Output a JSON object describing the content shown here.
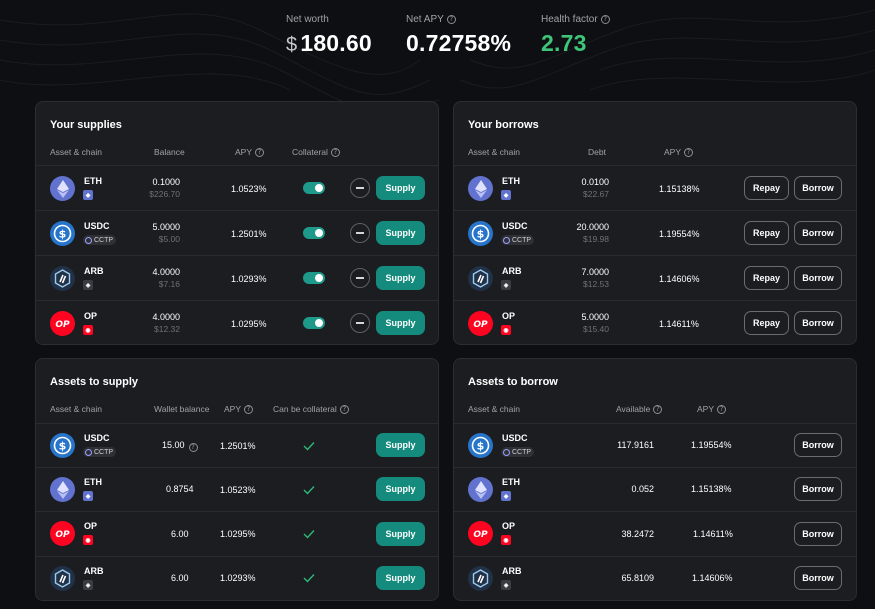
{
  "stats": {
    "net_worth_label": "Net worth",
    "net_worth_currency": "$",
    "net_worth_value": "180.60",
    "net_apy_label": "Net APY",
    "net_apy_value": "0.72758%",
    "health_label": "Health factor",
    "health_value": "2.73",
    "health_color": "#3fc57a"
  },
  "supplies": {
    "title": "Your supplies",
    "headers": {
      "asset": "Asset & chain",
      "balance": "Balance",
      "apy": "APY",
      "collateral": "Collateral"
    },
    "rows": [
      {
        "asset": "ETH",
        "icon": "eth-icon",
        "chain": "eth-chain-badge",
        "balance": "0.1000",
        "usd": "$226.70",
        "apy": "1.0523%",
        "collateral": true,
        "action": "Supply"
      },
      {
        "asset": "USDC",
        "icon": "usdc-icon",
        "chain": "cctp-badge",
        "chain_label": "CCTP",
        "balance": "5.0000",
        "usd": "$5.00",
        "apy": "1.2501%",
        "collateral": true,
        "action": "Supply"
      },
      {
        "asset": "ARB",
        "icon": "arb-icon",
        "chain": "arb-chain-badge",
        "balance": "4.0000",
        "usd": "$7.16",
        "apy": "1.0293%",
        "collateral": true,
        "action": "Supply"
      },
      {
        "asset": "OP",
        "icon": "op-icon",
        "chain": "op-chain-badge",
        "balance": "4.0000",
        "usd": "$12.32",
        "apy": "1.0295%",
        "collateral": true,
        "action": "Supply"
      }
    ]
  },
  "borrows": {
    "title": "Your borrows",
    "headers": {
      "asset": "Asset & chain",
      "debt": "Debt",
      "apy": "APY"
    },
    "repay_label": "Repay",
    "borrow_label": "Borrow",
    "rows": [
      {
        "asset": "ETH",
        "icon": "eth-icon",
        "debt": "0.0100",
        "usd": "$22.67",
        "apy": "1.15138%"
      },
      {
        "asset": "USDC",
        "icon": "usdc-icon",
        "chain_label": "CCTP",
        "debt": "20.0000",
        "usd": "$19.98",
        "apy": "1.19554%"
      },
      {
        "asset": "ARB",
        "icon": "arb-icon",
        "debt": "7.0000",
        "usd": "$12.53",
        "apy": "1.14606%"
      },
      {
        "asset": "OP",
        "icon": "op-icon",
        "debt": "5.0000",
        "usd": "$15.40",
        "apy": "1.14611%"
      }
    ]
  },
  "assets_to_supply": {
    "title": "Assets to supply",
    "headers": {
      "asset": "Asset & chain",
      "wallet": "Wallet balance",
      "apy": "APY",
      "collateral": "Can be collateral"
    },
    "supply_label": "Supply",
    "rows": [
      {
        "asset": "USDC",
        "icon": "usdc-icon",
        "chain_label": "CCTP",
        "wallet": "15.00",
        "apy": "1.2501%",
        "can_collateral": true
      },
      {
        "asset": "ETH",
        "icon": "eth-icon",
        "wallet": "0.8754",
        "apy": "1.0523%",
        "can_collateral": true
      },
      {
        "asset": "OP",
        "icon": "op-icon",
        "wallet": "6.00",
        "apy": "1.0295%",
        "can_collateral": true
      },
      {
        "asset": "ARB",
        "icon": "arb-icon",
        "wallet": "6.00",
        "apy": "1.0293%",
        "can_collateral": true
      }
    ]
  },
  "assets_to_borrow": {
    "title": "Assets to borrow",
    "headers": {
      "asset": "Asset & chain",
      "available": "Available",
      "apy": "APY"
    },
    "borrow_label": "Borrow",
    "rows": [
      {
        "asset": "USDC",
        "icon": "usdc-icon",
        "chain_label": "CCTP",
        "available": "117.9161",
        "apy": "1.19554%"
      },
      {
        "asset": "ETH",
        "icon": "eth-icon",
        "available": "0.052",
        "apy": "1.15138%"
      },
      {
        "asset": "OP",
        "icon": "op-icon",
        "available": "38.2472",
        "apy": "1.14611%"
      },
      {
        "asset": "ARB",
        "icon": "arb-icon",
        "available": "65.8109",
        "apy": "1.14606%"
      }
    ]
  },
  "colors": {
    "accent": "#148b7c",
    "background": "#0e0f12",
    "panel": "#1c1d21"
  }
}
